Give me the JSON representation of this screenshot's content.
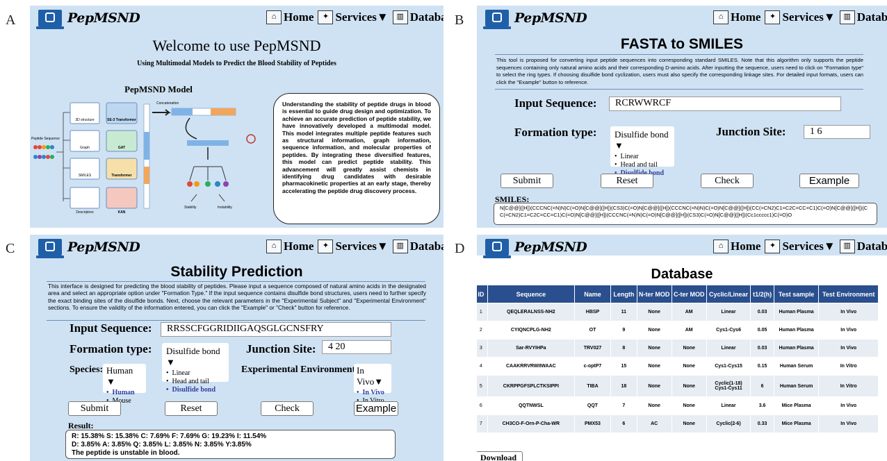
{
  "panel_labels": {
    "a": "A",
    "b": "B",
    "c": "C",
    "d": "D"
  },
  "header": {
    "logo": "PepMSND",
    "nav": [
      {
        "label": "Home",
        "icon": "home-icon"
      },
      {
        "label": "Services▼",
        "icon": "services-icon"
      },
      {
        "label": "Database",
        "icon": "database-icon"
      }
    ]
  },
  "home": {
    "title": "Welcome to use PepMSND",
    "subtitle": "Using Multimodal Models to Predict the Blood Stability of Peptides",
    "model_title": "PepMSND Model",
    "diagram": {
      "input": "Peptide Sequence",
      "features": [
        "3D structure",
        "Graph",
        "SMILES",
        "Descriptors"
      ],
      "models": [
        "SE-3 Transformer",
        "GAT",
        "Transformer",
        "KAN"
      ],
      "concat": "Concatenation",
      "outputs": [
        "Stability",
        "Instability"
      ]
    },
    "description": "Understanding the stability of peptide drugs in blood is essential to guide drug design and optimization. To achieve an accurate prediction of peptide stability, we have innovatively developed a multimodal model. This model integrates multiple peptide features such as structural information, graph information, sequence information, and molecular properties of peptides. By integrating these diversified features, this model can predict peptide stability. This advancement will greatly assist chemists in identifying drug candidates with desirable pharmacokinetic properties at an early stage, thereby accelerating the peptide drug discovery process."
  },
  "fasta": {
    "title": "FASTA to SMILES",
    "intro": "This tool is proposed for converting input peptide sequences into corresponding standard SMILES. Note that this algorithm only supports the peptide sequences containing only natural amino acids and their corresponding D-amino acids. After inputting the sequence, users need to click on \"Formation type\" to select the ring types. If choosing disulfide bond cyclization, users must also specify the corresponding linkage sites. For detailed input formats, users can click the \"Example\" button to reference.",
    "input_label": "Input Sequence:",
    "input_value": "RCRWWRCF",
    "formation_label": "Formation type:",
    "formation_selected": "Disulfide bond ▼",
    "formation_options": [
      "Linear",
      "Head and tail",
      "Disulfide bond"
    ],
    "junction_label": "Junction Site:",
    "junction_value": "1 6",
    "buttons": {
      "submit": "Submit",
      "reset": "Reset",
      "check": "Check",
      "example": "Example"
    },
    "smiles_label": "SMILES:",
    "smiles_value": "N[C@@]([H])(CCCNC(=N)N)C(=O)N[C@@]([H])(CS3)C(=O)N[C@@]([H])(CCCNC(=N)N)C(=O)N[C@@]([H])(CC(=CN2)C1=C2C=CC=C1)C(=O)N[C@@]([H])(CC(=CN2)C1=C2C=CC=C1)C(=O)N[C@@]([H])(CCCNC(=N)N)C(=O)N[C@@]([H])(CS3)C(=O)N[C@@]([H])(Cc1ccccc1)C(=O)O"
  },
  "stability": {
    "title": "Stability Prediction",
    "intro": "This interface is designed for predicting the blood stability of peptides. Please input a sequence composed of natural amino acids in the designated area and select an appropriate option under \"Formation Type.\" If the input sequence contains disulfide bond structures, users need to further specify the exact binding sites of the disulfide bonds. Next, choose the relevant parameters in the \"Experimental Subject\" and \"Experimental Environment\" sections. To ensure the validity of the information entered, you can click the \"Example\" or \"Check\" button for reference.",
    "input_label": "Input Sequence:",
    "input_value": "RRSSCFGGRIDIIGAQSGLGCNSFRY",
    "formation_label": "Formation type:",
    "formation_selected": "Disulfide bond ▼",
    "formation_options": [
      "Linear",
      "Head and tail",
      "Disulfide bond"
    ],
    "junction_label": "Junction Site:",
    "junction_value": "4 20",
    "species_label": "Species:",
    "species_selected": "Human ▼",
    "species_options": [
      "Human",
      "Mouse"
    ],
    "env_label": "Experimental Environment:",
    "env_selected": "In Vivo▼",
    "env_options": [
      "In Vivo",
      "In Vitro"
    ],
    "buttons": {
      "submit": "Submit",
      "reset": "Reset",
      "check": "Check",
      "example": "Example"
    },
    "result_label": "Result:",
    "result_lines": [
      "R: 15.38% S: 15.38% C: 7.69% F: 7.69% G: 19.23% I: 11.54%",
      "D: 3.85% A: 3.85% Q: 3.85% L: 3.85% N: 3.85% Y:3.85%",
      "The peptide is unstable in blood."
    ]
  },
  "database": {
    "title": "Database",
    "columns": [
      "ID",
      "Sequence",
      "Name",
      "Length",
      "N-ter MOD",
      "C-ter MOD",
      "Cyclic/Linear",
      "t1/2(h)",
      "Test sample",
      "Test Environment"
    ],
    "rows": [
      [
        "1",
        "QEQLERALNSS-NH2",
        "HBSP",
        "11",
        "None",
        "AM",
        "Linear",
        "0.03",
        "Human Plasma",
        "In Vivo"
      ],
      [
        "2",
        "CYIQNCPLG-NH2",
        "OT",
        "9",
        "None",
        "AM",
        "Cys1-Cys6",
        "0.05",
        "Human Plasma",
        "In Vivo"
      ],
      [
        "3",
        "Sar-RVYIHPa",
        "TRV027",
        "8",
        "None",
        "None",
        "Linear",
        "0.03",
        "Human Plasma",
        "In Vivo"
      ],
      [
        "4",
        "CAAKRRVRWIIWAAC",
        "c-optP7",
        "15",
        "None",
        "None",
        "Cys1-Cys15",
        "0.15",
        "Human Serum",
        "In Vitro"
      ],
      [
        "5",
        "CKRPPGFSPLCTKSIPPI",
        "TIBA",
        "18",
        "None",
        "None",
        "Cyclic(1-18) Cys1-Cys11",
        "6",
        "Human Serum",
        "In Vitro"
      ],
      [
        "6",
        "QQTNWSL",
        "QQT",
        "7",
        "None",
        "None",
        "Linear",
        "3.6",
        "Mice Plasma",
        "In Vivo"
      ],
      [
        "7",
        "CH3CO-F-Orn-P-Cha-WR",
        "PMX53",
        "6",
        "AC",
        "None",
        "Cyclic(2-6)",
        "0.33",
        "Mice Plasma",
        "In Vivo"
      ]
    ],
    "download": "Download"
  }
}
